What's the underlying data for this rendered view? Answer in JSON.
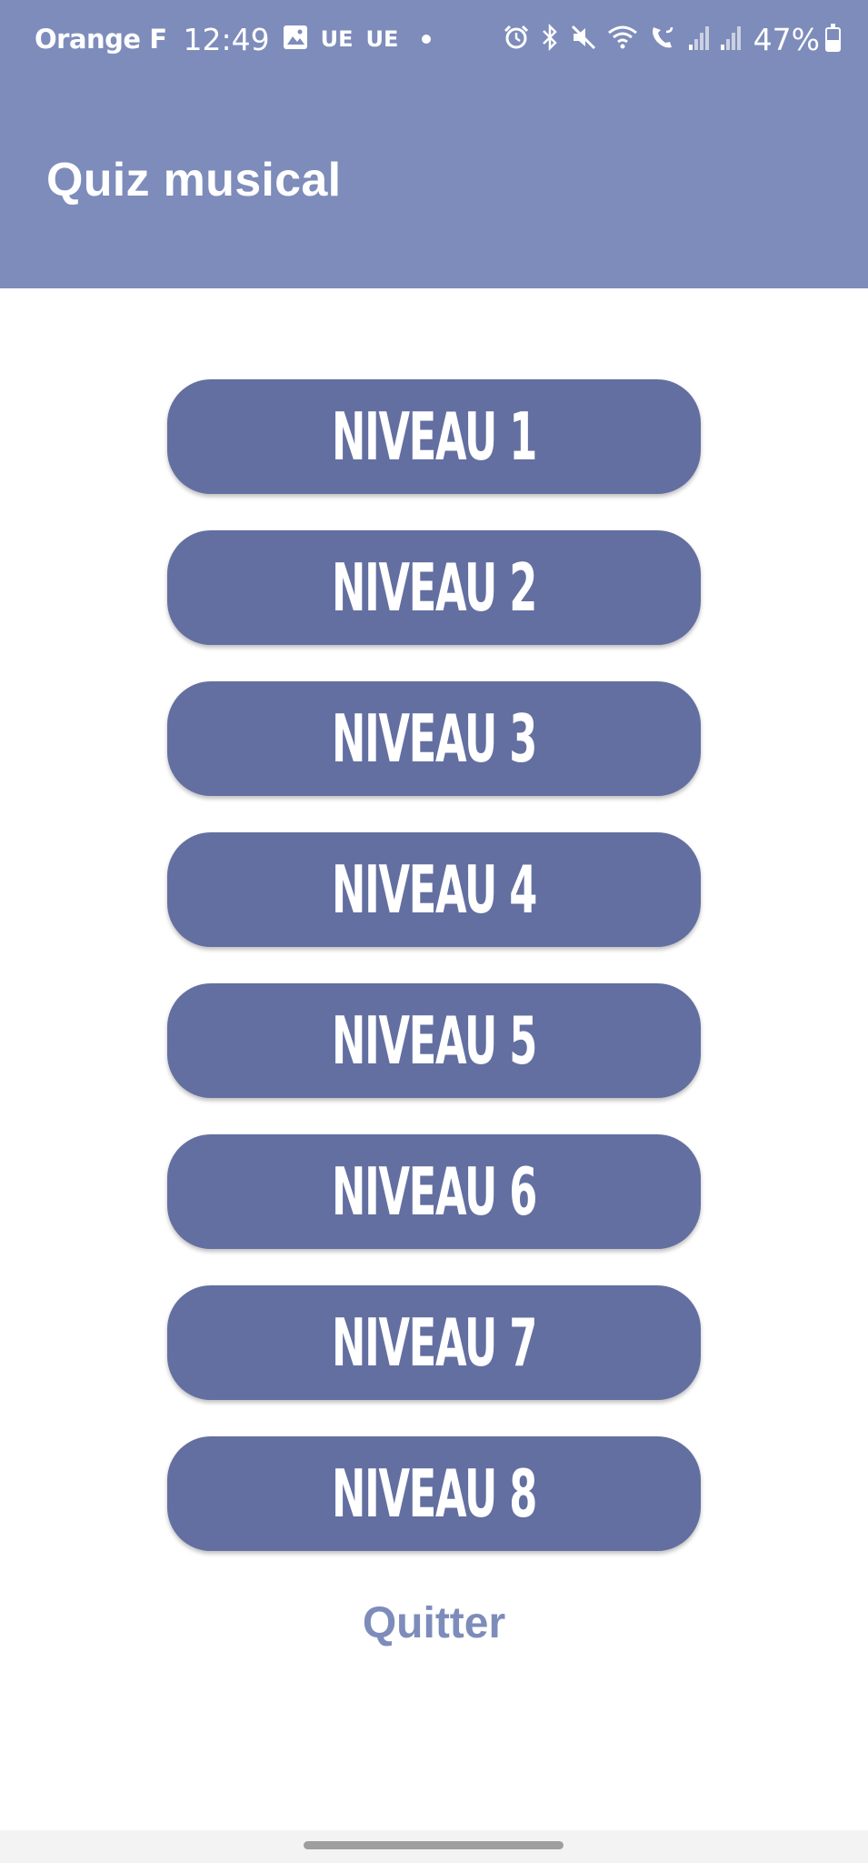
{
  "status_bar": {
    "carrier": "Orange F",
    "time": "12:49",
    "network_badges": [
      "UE",
      "UE"
    ],
    "battery_percent": "47%",
    "battery_level": 0.47,
    "icons": [
      "gallery-icon",
      "alarm-icon",
      "bluetooth-icon",
      "mute-icon",
      "wifi-icon",
      "wifi-calling-icon",
      "signal-icon",
      "signal-icon",
      "battery-icon"
    ]
  },
  "app_bar": {
    "title": "Quiz musical"
  },
  "levels": [
    {
      "label": "NIVEAU 1"
    },
    {
      "label": "NIVEAU 2"
    },
    {
      "label": "NIVEAU 3"
    },
    {
      "label": "NIVEAU 4"
    },
    {
      "label": "NIVEAU 5"
    },
    {
      "label": "NIVEAU 6"
    },
    {
      "label": "NIVEAU 7"
    },
    {
      "label": "NIVEAU 8"
    }
  ],
  "quit_label": "Quitter",
  "colors": {
    "app_bar": "#7d8cba",
    "button": "#636fa0",
    "button_text": "#ffffff",
    "quit_text": "#7d8cba",
    "background": "#ffffff"
  }
}
